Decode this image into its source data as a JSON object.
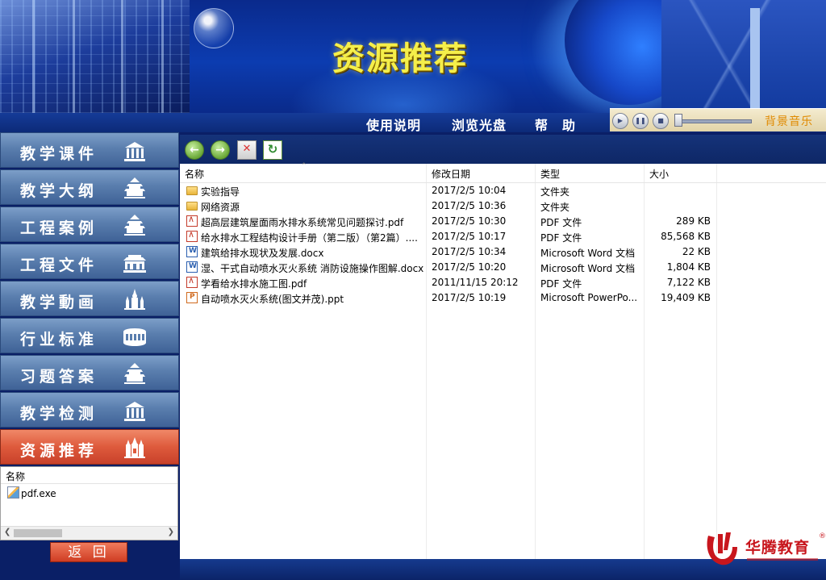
{
  "banner": {
    "title": "资源推荐"
  },
  "nav": {
    "items": [
      "使用说明",
      "浏览光盘",
      "帮　助"
    ]
  },
  "music": {
    "label": "背景音乐",
    "icons": [
      "play-icon",
      "pause-icon",
      "stop-icon"
    ]
  },
  "menu": {
    "items": [
      {
        "label": "教学课件",
        "icon": "building-columns-icon",
        "active": false
      },
      {
        "label": "教学大纲",
        "icon": "temple-icon",
        "active": false
      },
      {
        "label": "工程案例",
        "icon": "temple-icon",
        "active": false
      },
      {
        "label": "工程文件",
        "icon": "palace-icon",
        "active": false
      },
      {
        "label": "教学動画",
        "icon": "kremlin-icon",
        "active": false
      },
      {
        "label": "行业标准",
        "icon": "colosseum-icon",
        "active": false
      },
      {
        "label": "习题答案",
        "icon": "temple-icon",
        "active": false
      },
      {
        "label": "教学检测",
        "icon": "building-columns-icon",
        "active": false
      },
      {
        "label": "资源推荐",
        "icon": "cathedral-icon",
        "active": true
      }
    ]
  },
  "mini_list": {
    "header": "名称",
    "files": [
      "pdf.exe"
    ],
    "back_label": "返 回"
  },
  "explorer": {
    "toolbar": [
      "back-icon",
      "forward-icon",
      "stop-icon",
      "refresh-icon"
    ],
    "columns": {
      "name": "名称",
      "date": "修改日期",
      "type": "类型",
      "size": "大小"
    },
    "rows": [
      {
        "name": "实验指导",
        "date": "2017/2/5 10:04",
        "type": "文件夹",
        "size": "",
        "icon": "folder"
      },
      {
        "name": "网络资源",
        "date": "2017/2/5 10:36",
        "type": "文件夹",
        "size": "",
        "icon": "folder"
      },
      {
        "name": "超高层建筑屋面雨水排水系统常见问题探讨.pdf",
        "date": "2017/2/5 10:30",
        "type": "PDF 文件",
        "size": "289 KB",
        "icon": "pdf"
      },
      {
        "name": "给水排水工程结构设计手册（第二版）（第2篇）....",
        "date": "2017/2/5 10:17",
        "type": "PDF 文件",
        "size": "85,568 KB",
        "icon": "pdf"
      },
      {
        "name": "建筑给排水现状及发展.docx",
        "date": "2017/2/5 10:34",
        "type": "Microsoft Word 文档",
        "size": "22 KB",
        "icon": "doc"
      },
      {
        "name": "湿、干式自动喷水灭火系统 消防设施操作图解.docx",
        "date": "2017/2/5 10:20",
        "type": "Microsoft Word 文档",
        "size": "1,804 KB",
        "icon": "doc"
      },
      {
        "name": "学看给水排水施工图.pdf",
        "date": "2011/11/15 20:12",
        "type": "PDF 文件",
        "size": "7,122 KB",
        "icon": "pdf"
      },
      {
        "name": "自动喷水灭火系统(图文并茂).ppt",
        "date": "2017/2/5 10:19",
        "type": "Microsoft PowerPo...",
        "size": "19,409 KB",
        "icon": "ppt"
      }
    ]
  },
  "logo": {
    "text": "华腾教育",
    "mark": "®"
  },
  "colors": {
    "title_yellow": "#f5ef4a",
    "active_menu": "#de5a3c",
    "logo_red": "#c8161d",
    "music_label": "#e08a00"
  }
}
